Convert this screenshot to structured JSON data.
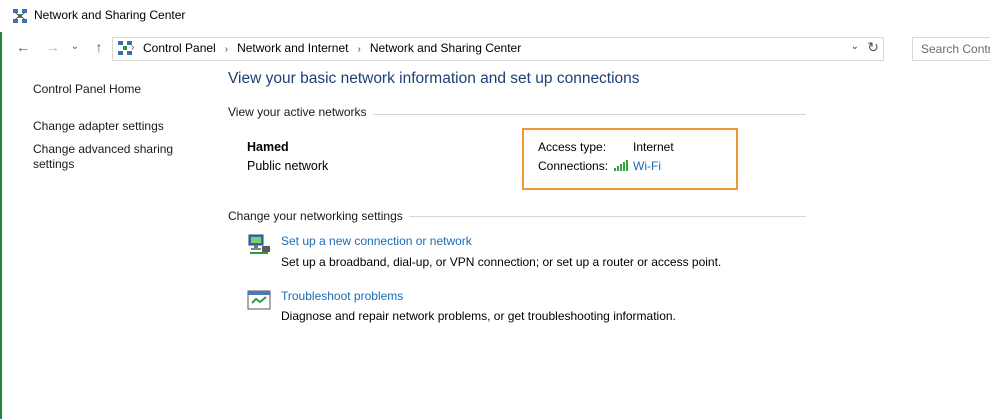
{
  "window": {
    "title": "Network and Sharing Center"
  },
  "nav": {
    "back": "←",
    "forward": "→",
    "recent": "⌄",
    "up": "↑",
    "breadcrumbs": [
      "Control Panel",
      "Network and Internet",
      "Network and Sharing Center"
    ],
    "separator": "›",
    "dropdown": "⌄",
    "refresh": "↻",
    "search_placeholder": "Search Contr"
  },
  "sidebar": {
    "items": [
      {
        "label": "Control Panel Home"
      },
      {
        "label": "Change adapter settings"
      },
      {
        "label": "Change advanced sharing"
      },
      {
        "label": "settings"
      }
    ]
  },
  "main": {
    "heading": "View your basic network information and set up connections",
    "active_networks_label": "View your active networks",
    "network": {
      "name": "Hamed",
      "type": "Public network",
      "access_type_label": "Access type:",
      "access_type_value": "Internet",
      "connections_label": "Connections:",
      "connections_value": "Wi-Fi"
    },
    "networking_settings_label": "Change your networking settings",
    "tasks": [
      {
        "title": "Set up a new connection or network",
        "description": "Set up a broadband, dial-up, or VPN connection; or set up a router or access point."
      },
      {
        "title": "Troubleshoot problems",
        "description": "Diagnose and repair network problems, or get troubleshooting information."
      }
    ]
  },
  "colors": {
    "heading": "#1e3f75",
    "link": "#1a6cb5",
    "highlight": "#f09737",
    "accent_stripe": "#1f8a3b"
  }
}
